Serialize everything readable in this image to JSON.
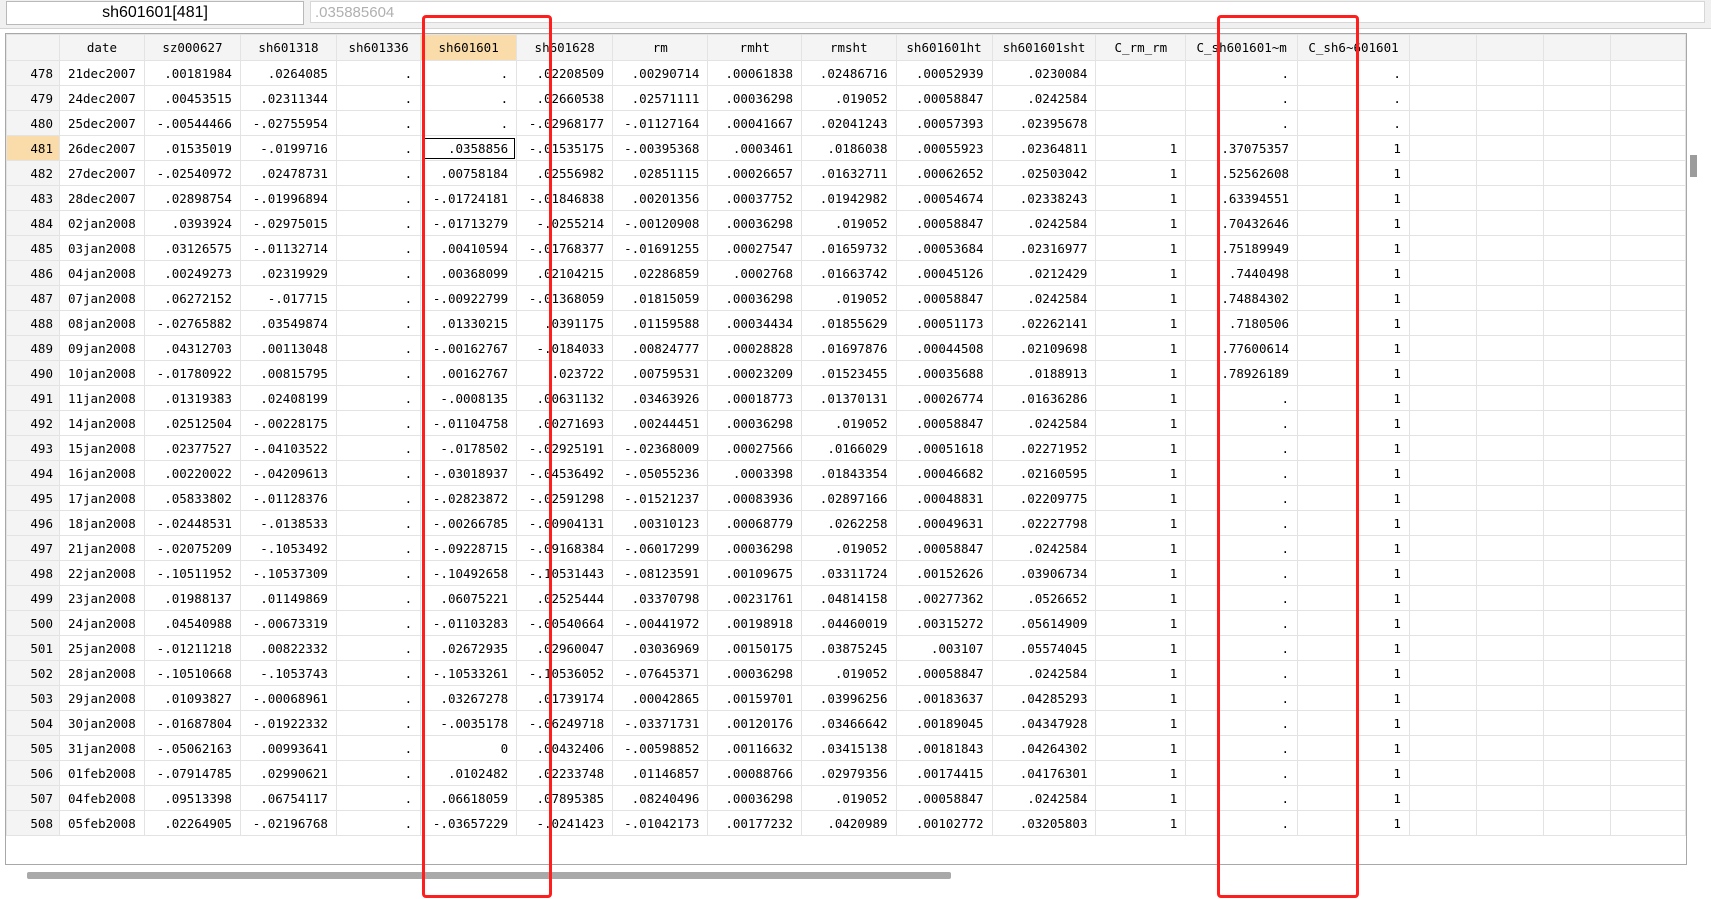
{
  "toolbar": {
    "cell_reference": "sh601601[481]",
    "cell_value": ".035885604"
  },
  "grid": {
    "columns": [
      "",
      "date",
      "sz000627",
      "sh601318",
      "sh601336",
      "sh601601",
      "sh601628",
      "rm",
      "rmht",
      "rmsht",
      "sh601601ht",
      "sh601601sht",
      "C_rm_rm",
      "C_sh601601~m",
      "C_sh6~601601",
      "",
      "",
      "",
      ""
    ],
    "rows": [
      [
        "478",
        "21dec2007",
        ".00181984",
        ".0264085",
        ".",
        ".",
        ".02208509",
        ".00290714",
        ".00061838",
        ".02486716",
        ".00052939",
        ".0230084",
        "",
        ".",
        "."
      ],
      [
        "479",
        "24dec2007",
        ".00453515",
        ".02311344",
        ".",
        ".",
        ".02660538",
        ".02571111",
        ".00036298",
        ".019052",
        ".00058847",
        ".0242584",
        "",
        ".",
        "."
      ],
      [
        "480",
        "25dec2007",
        "-.00544466",
        "-.02755954",
        ".",
        ".",
        "-.02968177",
        "-.01127164",
        ".00041667",
        ".02041243",
        ".00057393",
        ".02395678",
        "",
        ".",
        "."
      ],
      [
        "481",
        "26dec2007",
        ".01535019",
        "-.0199716",
        ".",
        ".0358856",
        "-.01535175",
        "-.00395368",
        ".0003461",
        ".0186038",
        ".00055923",
        ".02364811",
        "1",
        ".37075357",
        "1"
      ],
      [
        "482",
        "27dec2007",
        "-.02540972",
        ".02478731",
        ".",
        ".00758184",
        ".02556982",
        ".02851115",
        ".00026657",
        ".01632711",
        ".00062652",
        ".02503042",
        "1",
        ".52562608",
        "1"
      ],
      [
        "483",
        "28dec2007",
        ".02898754",
        "-.01996894",
        ".",
        "-.01724181",
        "-.01846838",
        ".00201356",
        ".00037752",
        ".01942982",
        ".00054674",
        ".02338243",
        "1",
        ".63394551",
        "1"
      ],
      [
        "484",
        "02jan2008",
        ".0393924",
        "-.02975015",
        ".",
        "-.01713279",
        "-.0255214",
        "-.00120908",
        ".00036298",
        ".019052",
        ".00058847",
        ".0242584",
        "1",
        ".70432646",
        "1"
      ],
      [
        "485",
        "03jan2008",
        ".03126575",
        "-.01132714",
        ".",
        ".00410594",
        "-.01768377",
        "-.01691255",
        ".00027547",
        ".01659732",
        ".00053684",
        ".02316977",
        "1",
        ".75189949",
        "1"
      ],
      [
        "486",
        "04jan2008",
        ".00249273",
        ".02319929",
        ".",
        ".00368099",
        ".02104215",
        ".02286859",
        ".0002768",
        ".01663742",
        ".00045126",
        ".0212429",
        "1",
        ".7440498",
        "1"
      ],
      [
        "487",
        "07jan2008",
        ".06272152",
        "-.017715",
        ".",
        "-.00922799",
        "-.01368059",
        ".01815059",
        ".00036298",
        ".019052",
        ".00058847",
        ".0242584",
        "1",
        ".74884302",
        "1"
      ],
      [
        "488",
        "08jan2008",
        "-.02765882",
        ".03549874",
        ".",
        ".01330215",
        ".0391175",
        ".01159588",
        ".00034434",
        ".01855629",
        ".00051173",
        ".02262141",
        "1",
        ".7180506",
        "1"
      ],
      [
        "489",
        "09jan2008",
        ".04312703",
        ".00113048",
        ".",
        "-.00162767",
        "-.0184033",
        ".00824777",
        ".00028828",
        ".01697876",
        ".00044508",
        ".02109698",
        "1",
        ".77600614",
        "1"
      ],
      [
        "490",
        "10jan2008",
        "-.01780922",
        ".00815795",
        ".",
        ".00162767",
        ".023722",
        ".00759531",
        ".00023209",
        ".01523455",
        ".00035688",
        ".0188913",
        "1",
        ".78926189",
        "1"
      ],
      [
        "491",
        "11jan2008",
        ".01319383",
        ".02408199",
        ".",
        "-.0008135",
        ".00631132",
        ".03463926",
        ".00018773",
        ".01370131",
        ".00026774",
        ".01636286",
        "1",
        ".",
        "1"
      ],
      [
        "492",
        "14jan2008",
        ".02512504",
        "-.00228175",
        ".",
        "-.01104758",
        ".00271693",
        ".00244451",
        ".00036298",
        ".019052",
        ".00058847",
        ".0242584",
        "1",
        ".",
        "1"
      ],
      [
        "493",
        "15jan2008",
        ".02377527",
        "-.04103522",
        ".",
        "-.0178502",
        "-.02925191",
        "-.02368009",
        ".00027566",
        ".0166029",
        ".00051618",
        ".02271952",
        "1",
        ".",
        "1"
      ],
      [
        "494",
        "16jan2008",
        ".00220022",
        "-.04209613",
        ".",
        "-.03018937",
        "-.04536492",
        "-.05055236",
        ".0003398",
        ".01843354",
        ".00046682",
        ".02160595",
        "1",
        ".",
        "1"
      ],
      [
        "495",
        "17jan2008",
        ".05833802",
        "-.01128376",
        ".",
        "-.02823872",
        "-.02591298",
        "-.01521237",
        ".00083936",
        ".02897166",
        ".00048831",
        ".02209775",
        "1",
        ".",
        "1"
      ],
      [
        "496",
        "18jan2008",
        "-.02448531",
        "-.0138533",
        ".",
        "-.00266785",
        "-.00904131",
        ".00310123",
        ".00068779",
        ".0262258",
        ".00049631",
        ".02227798",
        "1",
        ".",
        "1"
      ],
      [
        "497",
        "21jan2008",
        "-.02075209",
        "-.1053492",
        ".",
        "-.09228715",
        "-.09168384",
        "-.06017299",
        ".00036298",
        ".019052",
        ".00058847",
        ".0242584",
        "1",
        ".",
        "1"
      ],
      [
        "498",
        "22jan2008",
        "-.10511952",
        "-.10537309",
        ".",
        "-.10492658",
        "-.10531443",
        "-.08123591",
        ".00109675",
        ".03311724",
        ".00152626",
        ".03906734",
        "1",
        ".",
        "1"
      ],
      [
        "499",
        "23jan2008",
        ".01988137",
        ".01149869",
        ".",
        ".06075221",
        ".02525444",
        ".03370798",
        ".00231761",
        ".04814158",
        ".00277362",
        ".0526652",
        "1",
        ".",
        "1"
      ],
      [
        "500",
        "24jan2008",
        ".04540988",
        "-.00673319",
        ".",
        "-.01103283",
        "-.00540664",
        "-.00441972",
        ".00198918",
        ".04460019",
        ".00315272",
        ".05614909",
        "1",
        ".",
        "1"
      ],
      [
        "501",
        "25jan2008",
        "-.01211218",
        ".00822332",
        ".",
        ".02672935",
        ".02960047",
        ".03036969",
        ".00150175",
        ".03875245",
        ".003107",
        ".05574045",
        "1",
        ".",
        "1"
      ],
      [
        "502",
        "28jan2008",
        "-.10510668",
        "-.1053743",
        ".",
        "-.10533261",
        "-.10536052",
        "-.07645371",
        ".00036298",
        ".019052",
        ".00058847",
        ".0242584",
        "1",
        ".",
        "1"
      ],
      [
        "503",
        "29jan2008",
        ".01093827",
        "-.00068961",
        ".",
        ".03267278",
        ".01739174",
        ".00042865",
        ".00159701",
        ".03996256",
        ".00183637",
        ".04285293",
        "1",
        ".",
        "1"
      ],
      [
        "504",
        "30jan2008",
        "-.01687804",
        "-.01922332",
        ".",
        "-.0035178",
        "-.06249718",
        "-.03371731",
        ".00120176",
        ".03466642",
        ".00189045",
        ".04347928",
        "1",
        ".",
        "1"
      ],
      [
        "505",
        "31jan2008",
        "-.05062163",
        ".00993641",
        ".",
        "0",
        ".00432406",
        "-.00598852",
        ".00116632",
        ".03415138",
        ".00181843",
        ".04264302",
        "1",
        ".",
        "1"
      ],
      [
        "506",
        "01feb2008",
        "-.07914785",
        ".02990621",
        ".",
        ".0102482",
        ".02233748",
        ".01146857",
        ".00088766",
        ".02979356",
        ".00174415",
        ".04176301",
        "1",
        ".",
        "1"
      ],
      [
        "507",
        "04feb2008",
        ".09513398",
        ".06754117",
        ".",
        ".06618059",
        ".07895385",
        ".08240496",
        ".00036298",
        ".019052",
        ".00058847",
        ".0242584",
        "1",
        ".",
        "1"
      ],
      [
        "508",
        "05feb2008",
        ".02264905",
        "-.02196768",
        ".",
        "-.03657229",
        "-.0241423",
        "-.01042173",
        ".00177232",
        ".0420989",
        ".00102772",
        ".03205803",
        "1",
        ".",
        "1"
      ]
    ],
    "selected_row": "481",
    "selected_column": "sh601601"
  },
  "highlight_color": "#ff1e1e",
  "selection_color": "#f9dcaa"
}
